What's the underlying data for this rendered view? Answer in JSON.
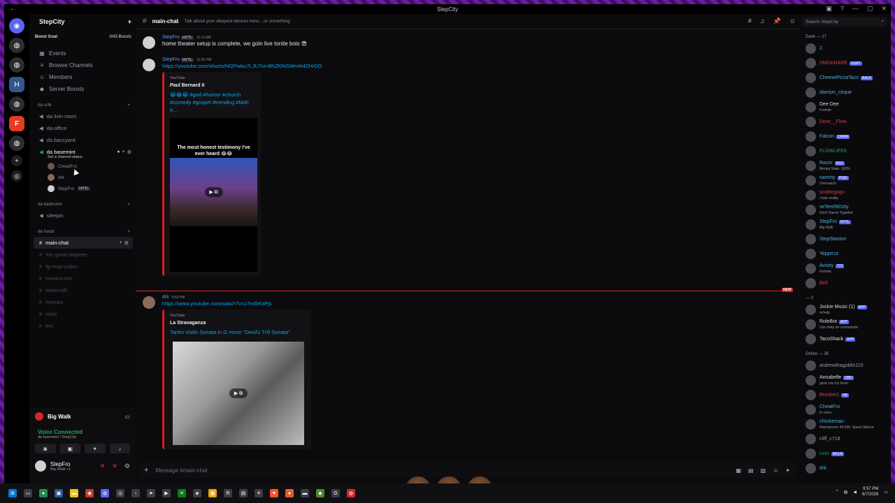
{
  "window": {
    "title": "StepCity"
  },
  "server": {
    "name": "StepCity",
    "boost_label": "Boost Goal",
    "boost_progress": "0/43 Boosts"
  },
  "nav": [
    {
      "label": "Events",
      "icon": "calendar-icon"
    },
    {
      "label": "Browse Channels",
      "icon": "channels-icon"
    },
    {
      "label": "Members",
      "icon": "members-icon"
    },
    {
      "label": "Server Boosts",
      "icon": "boost-icon"
    }
  ],
  "categories": {
    "crib": "da crib",
    "bedroom": "da bedroom",
    "hood": "da hood"
  },
  "crib_channels": [
    {
      "name": "da livin room"
    },
    {
      "name": "da-office"
    },
    {
      "name": "da baccyard"
    },
    {
      "name": "da basemint"
    }
  ],
  "set_status": "Set a channel status",
  "voice_users": [
    {
      "name": "CheatFro"
    },
    {
      "name": "drk"
    },
    {
      "name": "StepFro",
      "tag": "HYTL"
    }
  ],
  "bedroom_channels": [
    {
      "name": "sleepin"
    }
  ],
  "hood_channels": [
    {
      "name": "main-chat",
      "active": true
    },
    {
      "name": "the-great-steptree"
    },
    {
      "name": "fg-map-codes"
    },
    {
      "name": "mexico-sho"
    },
    {
      "name": "minecraft"
    },
    {
      "name": "memes"
    },
    {
      "name": "roles"
    },
    {
      "name": "bot"
    }
  ],
  "user_panel": {
    "activity": "Big Walk",
    "voice_status": "Voice Connected",
    "voice_location": "da basemint / StepCity",
    "username": "StepFro",
    "substatus": "Big Walk +1"
  },
  "chat": {
    "channel": "main-chat",
    "topic": "Talk about your deepest desires here....or something",
    "search_placeholder": "Search StepCity",
    "composer_placeholder": "Message #main-chat",
    "new_badge": "NEW"
  },
  "messages": [
    {
      "author": "StepFro",
      "tag": "HYTL",
      "time": "11:13 AM",
      "text": "home theater setup is complete, we goin live tonite bois 😎"
    },
    {
      "author": "StepFro",
      "tag": "HYTL",
      "time": "12:25 PM",
      "link": "https://youtube.com/shorts/Nf2Pwbu7LJU?si=BhZl0NSWmN4ZHrDO",
      "embed": {
        "provider": "YouTube",
        "title": "Paul Bernard II",
        "desc": "😂😂😂 #god #humor #church #comedy #gospel #trending #faith #...",
        "caption": "The most honest testimony I've ever heard 😂😂"
      }
    },
    {
      "author": "drk",
      "time": "9:53 PM",
      "link": "https://www.youtube.com/watch?v=z7rxl5KsPjs",
      "embed": {
        "provider": "YouTube",
        "title": "La Stravaganza",
        "desc": "Tartini Violin Sonata in G minor \"Devil's Trill Sonata\""
      }
    }
  ],
  "member_groups": {
    "dank": "Dank — 17",
    "bots": "— 3",
    "online": "Online — 35"
  },
  "members_dank": [
    {
      "name": "2",
      "color": "#5a9fe8"
    },
    {
      "name": "SMOKRARE",
      "color": "#e03c3c",
      "badge": "KLWT"
    },
    {
      "name": "CheesePizzaTaco",
      "color": "#4fb3e0",
      "badge": "BALD"
    },
    {
      "name": "damion_cirque",
      "color": "#4fb3e0"
    },
    {
      "name": "Dee Dee",
      "color": "#dbdee1",
      "status": "Fortnite"
    },
    {
      "name": "Doxx__Flow",
      "color": "#e03c3c"
    },
    {
      "name": "Falcon",
      "color": "#4fb3e0",
      "badge": "CRWN"
    },
    {
      "name": "FLOWLIFE6",
      "color": "#23a55a"
    },
    {
      "name": "Razor",
      "color": "#4fb3e0",
      "badge": "NSC",
      "status": "Mental State: 100%"
    },
    {
      "name": "sammy",
      "color": "#4fb3e0",
      "badge": "POKI",
      "status": "Overwatch"
    },
    {
      "name": "scottiegogo",
      "color": "#e03c3c",
      "status": "i hate reality"
    },
    {
      "name": "seTen0901tty",
      "color": "#4fb3e0",
      "status": "Don't Starve Together"
    },
    {
      "name": "StepFro",
      "color": "#4fb3e0",
      "badge": "HYTL",
      "status": "Big Walk"
    },
    {
      "name": "StepStanton",
      "color": "#4fb3e0"
    },
    {
      "name": "Yepprrzz",
      "color": "#4fb3e0"
    },
    {
      "name": "Avisity",
      "color": "#4fb3e0",
      "badge": "777",
      "status": "Fortnite"
    },
    {
      "name": "Bell",
      "color": "#e03c3c"
    }
  ],
  "members_bots": [
    {
      "name": "Jockie Music (1)",
      "color": "#dbdee1",
      "badge": "APP",
      "status": "m!help"
    },
    {
      "name": "RoleBot",
      "color": "#dbdee1",
      "badge": "APP",
      "status": "Use /help for commands!"
    },
    {
      "name": "TacoShack",
      "color": "#dbdee1",
      "badge": "APP"
    }
  ],
  "members_online": [
    {
      "name": "andrewthagoblin115",
      "color": "#9a9ca3"
    },
    {
      "name": "Annabelle",
      "color": "#dbdee1",
      "badge": "DBD",
      "status": "gave you my heart"
    },
    {
      "name": "Brooker1",
      "color": "#e03c3c",
      "badge": "HK"
    },
    {
      "name": "CheatFro",
      "color": "#4fb3e0",
      "status": "In voice"
    },
    {
      "name": "chickieman",
      "color": "#4fb3e0",
      "status": "Warhammer 40,000: Space Marine"
    },
    {
      "name": "cliff_c718",
      "color": "#9a9ca3"
    },
    {
      "name": "cvzx",
      "color": "#23a55a",
      "badge": "MULA"
    },
    {
      "name": "drk",
      "color": "#4fb3e0"
    }
  ],
  "clock": {
    "time": "9:57 PM",
    "date": "6/7/2026"
  }
}
